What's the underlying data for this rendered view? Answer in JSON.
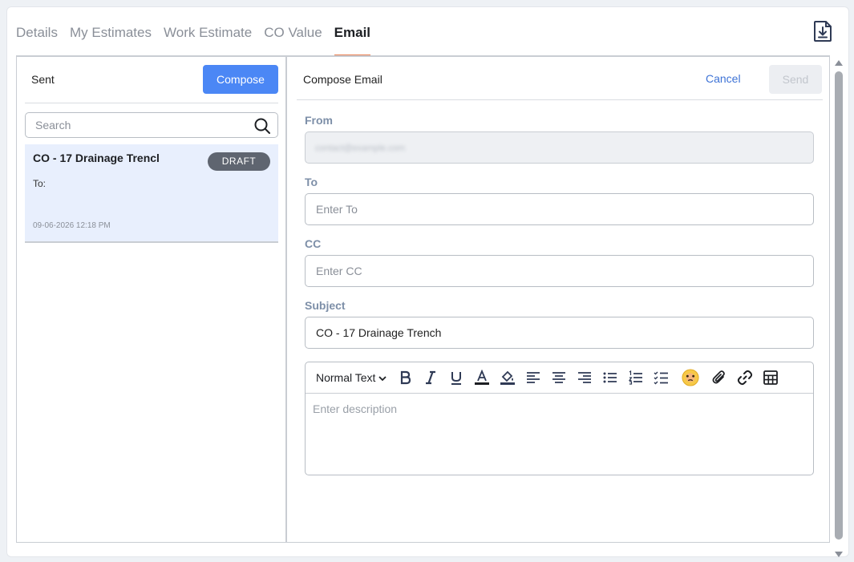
{
  "tabs": [
    {
      "label": "Details"
    },
    {
      "label": "My Estimates"
    },
    {
      "label": "Work Estimate"
    },
    {
      "label": "CO Value"
    },
    {
      "label": "Email",
      "active": true
    }
  ],
  "export_icon": "file-download-icon",
  "left": {
    "sent_label": "Sent",
    "compose_label": "Compose",
    "search_placeholder": "Search",
    "items": [
      {
        "subject": "CO - 17 Drainage Trencl",
        "badge": "DRAFT",
        "to": "To:",
        "date": "09-06-2026 12:18 PM"
      }
    ]
  },
  "compose": {
    "title": "Compose Email",
    "cancel_label": "Cancel",
    "send_label": "Send",
    "from_label": "From",
    "from_value": "contact@example.com",
    "to_label": "To",
    "to_placeholder": "Enter To",
    "cc_label": "CC",
    "cc_placeholder": "Enter CC",
    "subject_label": "Subject",
    "subject_value": "CO - 17 Drainage Trench",
    "toolbar_format": "Normal Text",
    "description_placeholder": "Enter description"
  },
  "colors": {
    "accent": "#4b87f5",
    "active_tab_underline": "#e97c4d",
    "selected_item_bg": "#e8effd",
    "badge_bg": "#5f6570",
    "label_color": "#7d8fa8"
  }
}
